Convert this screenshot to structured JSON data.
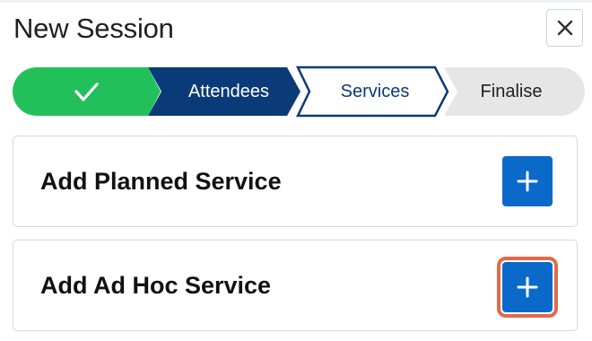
{
  "dialog": {
    "title": "New Session",
    "close_icon": "close-icon"
  },
  "stepper": {
    "steps": [
      {
        "label": "",
        "state": "completed",
        "icon": "check-icon",
        "color": "#22c05a"
      },
      {
        "label": "Attendees",
        "state": "visited",
        "color": "#0b3a78"
      },
      {
        "label": "Services",
        "state": "current",
        "color": "#ffffff"
      },
      {
        "label": "Finalise",
        "state": "upcoming",
        "color": "#e6e6e6"
      }
    ]
  },
  "cards": [
    {
      "title": "Add Planned Service",
      "button_icon": "plus-icon",
      "focused": false
    },
    {
      "title": "Add Ad Hoc Service",
      "button_icon": "plus-icon",
      "focused": true
    }
  ],
  "colors": {
    "primary": "#0b6ac9",
    "navy": "#0b3a78",
    "success": "#22c05a",
    "focus_ring": "#e06a4a"
  }
}
